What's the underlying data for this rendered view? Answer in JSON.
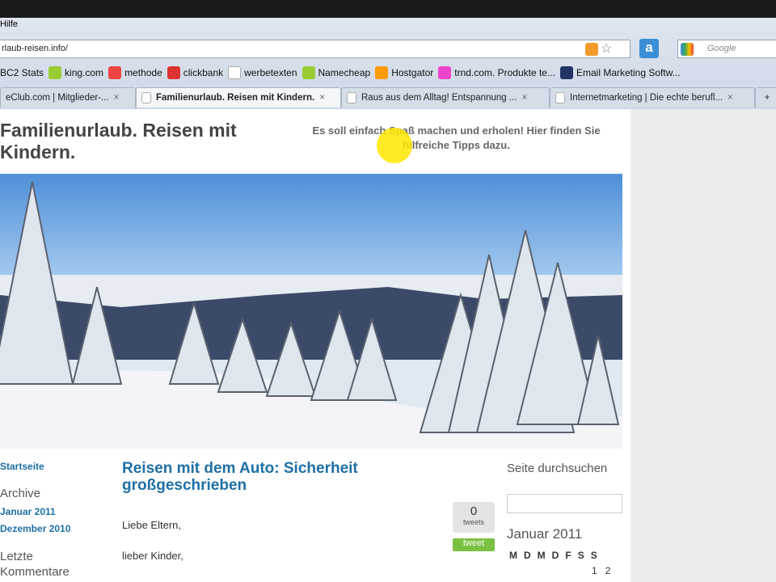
{
  "browser": {
    "menu": "Hilfe",
    "url": "rlaub-reisen.info/",
    "search_placeholder": "Google",
    "bookmarks": [
      "BC2 Stats",
      "king.com",
      "methode",
      "clickbank",
      "werbetexten",
      "Namecheap",
      "Hostgator",
      "trnd.com. Produkte te...",
      "Email Marketing Softw..."
    ],
    "tabs": [
      {
        "label": "eClub.com | Mitglieder-...",
        "active": false
      },
      {
        "label": "Familienurlaub. Reisen mit Kindern.",
        "active": true
      },
      {
        "label": "Raus aus dem Alltag! Entspannung ...",
        "active": false
      },
      {
        "label": "Internetmarketing | Die echte berufl...",
        "active": false
      }
    ],
    "new_tab": "+"
  },
  "site": {
    "title": "Familienurlaub. Reisen mit Kindern.",
    "tagline": "Es soll einfach Spaß machen und erholen! Hier finden Sie hilfreiche Tipps dazu."
  },
  "sidebar_left": {
    "home": "Startseite",
    "archive_heading": "Archive",
    "archive": [
      "Januar 2011",
      "Dezember 2010"
    ],
    "comments_heading": "Letzte Kommentare"
  },
  "post": {
    "title": "Reisen mit dem Auto: Sicherheit großgeschrieben",
    "p1": "Liebe Eltern,",
    "p2": "lieber Kinder,",
    "tweet_count": "0",
    "tweets_label": "tweets",
    "tweet_button": "tweet"
  },
  "sidebar_right": {
    "search_heading": "Seite durchsuchen",
    "calendar_heading": "Januar 2011",
    "weekdays": [
      "M",
      "D",
      "M",
      "D",
      "F",
      "S",
      "S"
    ],
    "days": [
      "1",
      "2"
    ]
  }
}
